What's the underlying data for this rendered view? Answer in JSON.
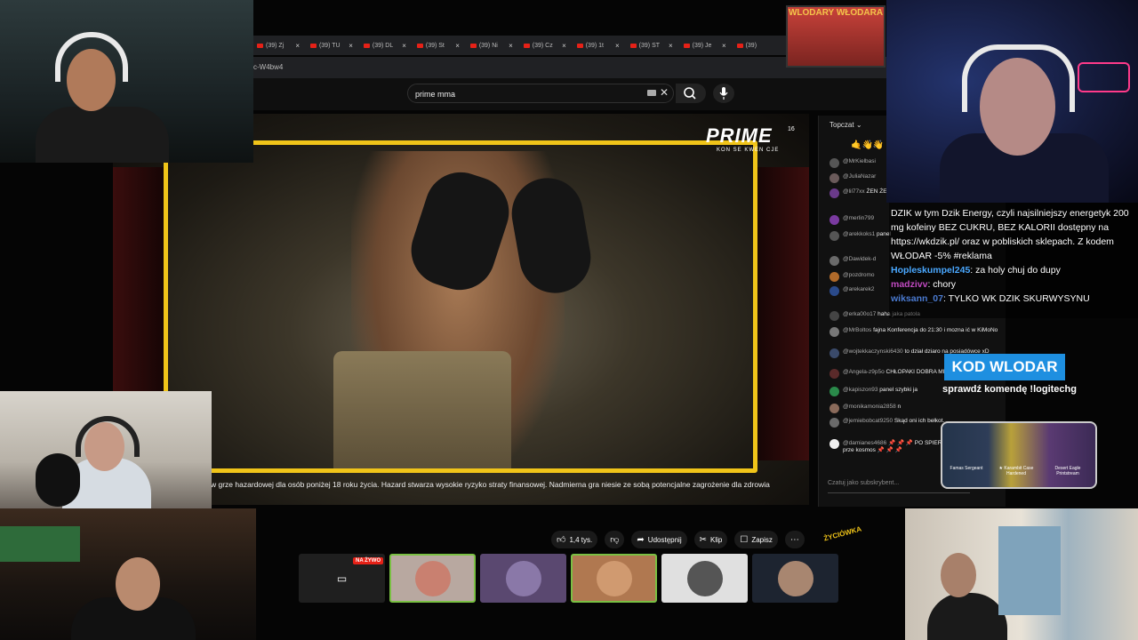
{
  "browser": {
    "tabs": [
      "(39) Zj",
      "(39) TU",
      "(39) DL",
      "(39) St",
      "(39) Ni",
      "(39) Cz",
      "(39) 1t",
      "(39) ST",
      "(39) Je",
      "(39)"
    ],
    "url_fragment": "c-W4bw4"
  },
  "youtube": {
    "search_value": "prime mma",
    "disclaimer": "w grze hazardowej dla osób poniżej 18 roku życia. Hazard stwarza wysokie ryzyko straty finansowej. Nadmierna gra niesie ze sobą potencjalne zagrożenie dla zdrowia",
    "actions": {
      "like_count": "1,4 tys.",
      "share": "Udostępnij",
      "clip": "Klip",
      "save": "Zapisz"
    }
  },
  "video_overlay": {
    "logo": "PRIME",
    "logo_number": "16",
    "logo_sub": "KON SE KWEN CJE"
  },
  "chat": {
    "header": "Topczat",
    "emojis": "🤙👋👋",
    "messages": [
      {
        "author": "@MrKielbasi",
        "text": "",
        "color": "#555"
      },
      {
        "author": "@JuliaNazar",
        "text": "",
        "color": "#6a5a5a"
      },
      {
        "author": "@lil77xx",
        "text": "ŻEN ŻENADA +1 2 ŻENADA +1V",
        "color": "#6a3a8a"
      },
      {
        "author": "@merlin799",
        "text": "",
        "color": "#7a3aa0"
      },
      {
        "author": "@arekkoks1",
        "text": "panel",
        "color": "#555"
      },
      {
        "author": "@Dawidek-d",
        "text": "",
        "color": "#6a6a6a"
      },
      {
        "author": "@pozdromo",
        "text": "",
        "color": "#b06a2a"
      },
      {
        "author": "@arekarek2",
        "text": "",
        "color": "#2a4a8a"
      },
      {
        "author": "@erka00o17",
        "text": "haha jaka patola",
        "color": "#444"
      },
      {
        "author": "@MrBoltos",
        "text": "fajna Konferencja do 21:30 i mozna ić w KiMoNo",
        "color": "#777"
      },
      {
        "author": "@wojtekkaczynski6430",
        "text": "to dział dziaro na posiadówce xD",
        "color": "#3a4a6a"
      },
      {
        "author": "@Angela-z9p5o",
        "text": "CHŁOPAKI DOBRA MINETE???",
        "color": "#5a2a2a"
      },
      {
        "author": "@kapiszon93",
        "text": "panel szybki ja",
        "color": "#2a8a4a"
      },
      {
        "author": "@monikamonia2858",
        "text": "n",
        "color": "#8a6a5a"
      },
      {
        "author": "@jemiebobcat9250",
        "text": "Skąd oni ich bełkot.",
        "color": "#6a6a6a"
      },
      {
        "author": "@damianes4686",
        "text": "📌 📌 📌 PO SPIERDOLENIA tej federacji prze kosmos 📌 📌 📌",
        "color": "#eee"
      }
    ],
    "input_placeholder": "Czatuj jako subskrybent..."
  },
  "stream_overlay": {
    "chat_lines": [
      {
        "name": "",
        "text": "DZIK w tym Dzik Energy, czyli najsilniejszy energetyk 200",
        "name_color": "#fff"
      },
      {
        "name": "",
        "text": "mg kofeiny BEZ CUKRU, BEZ KALORII dostępny na",
        "name_color": "#fff"
      },
      {
        "name": "",
        "text": "https://wkdzik.pl/ oraz w pobliskich sklepach. Z kodem",
        "name_color": "#fff"
      },
      {
        "name": "",
        "text": "WŁODAR -5% #reklama",
        "name_color": "#fff"
      },
      {
        "name": "Hopleskumpel245",
        "text": ": za holy chuj do dupy",
        "name_color": "#4aa8ff"
      },
      {
        "name": "madzivv",
        "text": ": chory",
        "name_color": "#c04ac0"
      },
      {
        "name": "wiksann_07",
        "text": ": TYLKO WK DZIK SKURWYSYNU",
        "name_color": "#4a7ad0"
      }
    ],
    "kod_label": "KOD WLODAR",
    "kod_sub": "sprawdź komendę !logitechg",
    "skins": [
      "Famas Sergeant",
      "★ Karambit Case Hardened",
      "Desert Eagle Printstream"
    ],
    "badge_text": "WLODARY WŁODARA",
    "zyciowka": "ŻYCIÓWKA"
  },
  "participants": {
    "live_label": "NA ŻYWO",
    "count": 6
  }
}
